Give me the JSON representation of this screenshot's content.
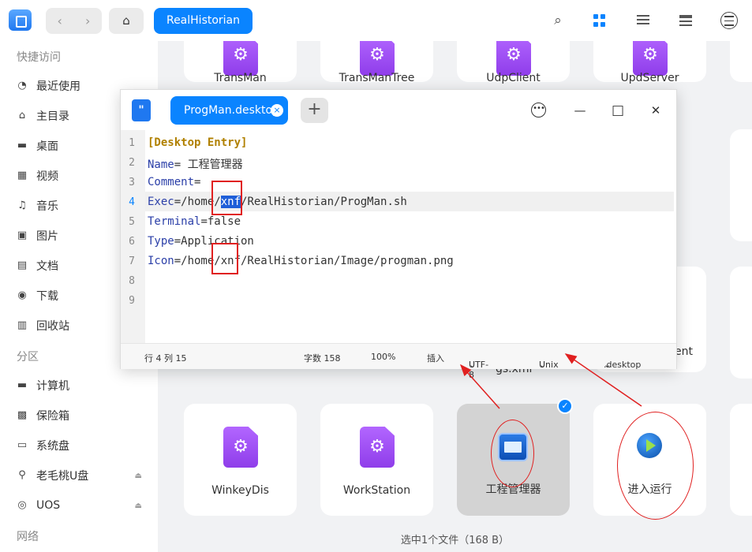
{
  "topbar": {
    "nav_back": "‹",
    "nav_forward": "›",
    "home_icon": "⌂",
    "breadcrumb": "RealHistorian",
    "search_icon": "⌕"
  },
  "sidebar": {
    "quick_access_heading": "快捷访问",
    "items": [
      {
        "icon": "◔",
        "label": "最近使用"
      },
      {
        "icon": "⌂",
        "label": "主目录"
      },
      {
        "icon": "▬",
        "label": "桌面"
      },
      {
        "icon": "▦",
        "label": "视频"
      },
      {
        "icon": "♫",
        "label": "音乐"
      },
      {
        "icon": "▣",
        "label": "图片"
      },
      {
        "icon": "▤",
        "label": "文档"
      },
      {
        "icon": "◉",
        "label": "下载"
      },
      {
        "icon": "▥",
        "label": "回收站"
      }
    ],
    "partition_heading": "分区",
    "partitions": [
      {
        "icon": "▬",
        "label": "计算机"
      },
      {
        "icon": "▩",
        "label": "保险箱"
      },
      {
        "icon": "▭",
        "label": "系统盘"
      },
      {
        "icon": "⚲",
        "label": "老毛桃U盘",
        "eject": "⏏"
      },
      {
        "icon": "◎",
        "label": "UOS",
        "eject": "⏏"
      }
    ],
    "network_heading": "网络"
  },
  "files": {
    "row1": [
      "TransMan",
      "TransManTree",
      "UdpClient",
      "UpdServer"
    ],
    "partial_right": "ent",
    "partial_under": "gs.xml",
    "row3": [
      "WinkeyDis",
      "WorkStation",
      "工程管理器",
      "进入运行"
    ]
  },
  "status_bar": "选中1个文件（168 B）",
  "editor": {
    "tab_label": "ProgMan.desktop",
    "tab_close": "×",
    "add_tab": "+",
    "more_icon": "•••",
    "minimize": "—",
    "maximize": "□",
    "close": "✕",
    "line_numbers": [
      "1",
      "2",
      "3",
      "4",
      "5",
      "6",
      "7",
      "8",
      "9"
    ],
    "code": {
      "l1": "[Desktop Entry]",
      "l2_key": "Name",
      "l2_val": "= 工程管理器",
      "l3_key": "Comment",
      "l3_val": "=",
      "l4_key": "Exec",
      "l4_pre": "=/home/",
      "l4_hl": "xnf",
      "l4_post": "/RealHistorian/ProgMan.sh",
      "l5_key": "Terminal",
      "l5_val": "=false",
      "l6_key": "Type",
      "l6_val": "=Application",
      "l7_key": "Icon",
      "l7_val": "=/home/xnf/RealHistorian/Image/progman.png"
    },
    "status": {
      "position": "行 4  列 15",
      "char_count": "字数 158",
      "zoom": "100%",
      "mode": "插入",
      "encoding": "UTF-8",
      "line_ending": "Unix",
      "syntax": ".desktop",
      "dropdown": "⌄"
    }
  },
  "colors": {
    "accent": "#0a84ff",
    "annotation": "#e02020"
  }
}
